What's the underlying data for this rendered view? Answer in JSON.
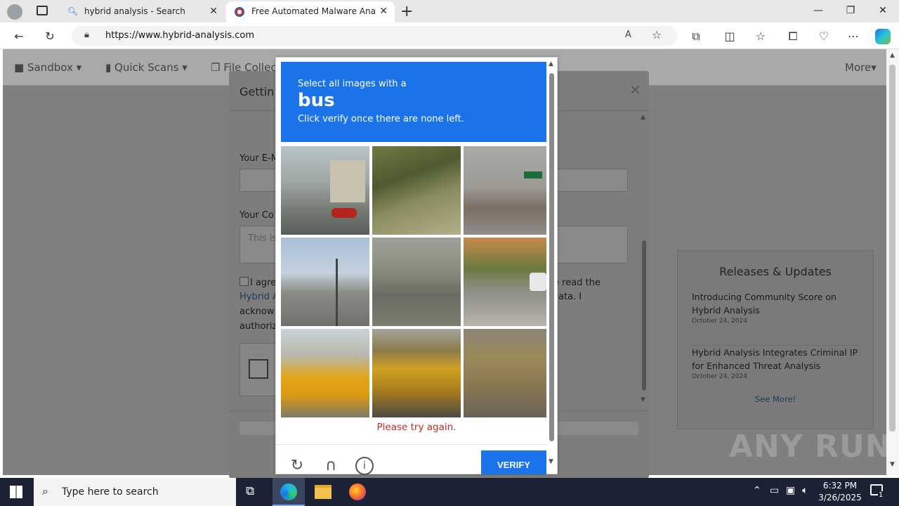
{
  "browser": {
    "tabs": [
      {
        "title": "hybrid analysis - Search",
        "active": false
      },
      {
        "title": "Free Automated Malware Analysis",
        "active": true
      }
    ],
    "url": "https://www.hybrid-analysis.com"
  },
  "site": {
    "nav": [
      "Sandbox",
      "Quick Scans",
      "File Collec",
      "More"
    ],
    "releases": {
      "heading": "Releases & Updates",
      "items": [
        {
          "title": "Introducing Community Score on Hybrid Analysis",
          "date": "October 24, 2024"
        },
        {
          "title": "Hybrid Analysis Integrates Criminal IP for Enhanced Threat Analysis",
          "date": "October 24, 2024"
        }
      ],
      "see_more": "See More!"
    },
    "watermark": "ANY RUN"
  },
  "modal": {
    "title": "Gettin",
    "email_label": "Your E-M",
    "comment_label": "Your Co",
    "comment_placeholder": "This is",
    "agree_lines": [
      "I agre",
      "Hybrid A",
      "acknow",
      "authoriz"
    ],
    "agree_right": [
      "e read the",
      "ata. I"
    ]
  },
  "captcha": {
    "instruction": "Select all images with a",
    "target": "bus",
    "hint": "Click verify once there are none left.",
    "error": "Please try again.",
    "verify_label": "VERIFY",
    "tiles": [
      {
        "desc": "street with building and red car"
      },
      {
        "desc": "trees and vegetation"
      },
      {
        "desc": "noisy road with sign"
      },
      {
        "desc": "overpass with street lights"
      },
      {
        "desc": "noisy highway"
      },
      {
        "desc": "road with trees and car"
      },
      {
        "desc": "school buses side view"
      },
      {
        "desc": "school bus front view"
      },
      {
        "desc": "noisy bus rear view"
      }
    ]
  },
  "taskbar": {
    "search_placeholder": "Type here to search",
    "time": "6:32 PM",
    "date": "3/26/2025",
    "notifications": "1"
  },
  "colors": {
    "captcha_blue": "#1a73e8",
    "error_red": "#c62828",
    "overlay_gray": "#7f7f7f"
  }
}
